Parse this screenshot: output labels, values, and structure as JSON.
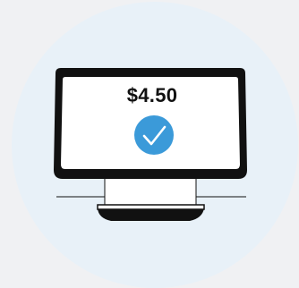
{
  "terminal": {
    "amount": "$4.50",
    "status_icon": "check-circle-icon"
  },
  "colors": {
    "background": "#f0f1f3",
    "circle": "#e8f1f8",
    "device_outline": "#111111",
    "screen_fill": "#ffffff",
    "check_badge": "#3b9ad9",
    "check_mark": "#ffffff"
  }
}
